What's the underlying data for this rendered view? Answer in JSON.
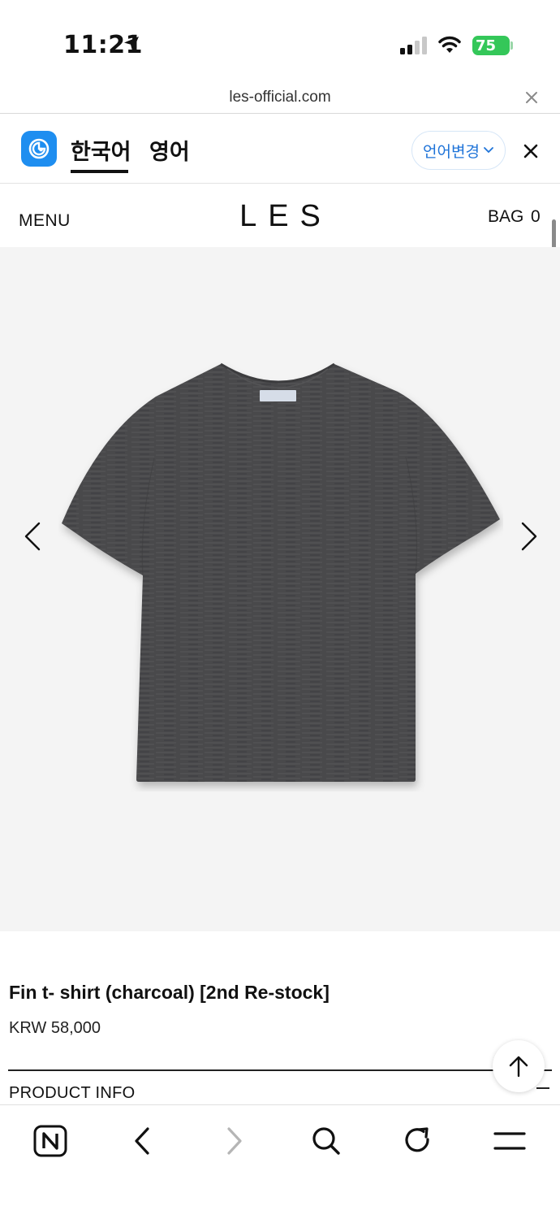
{
  "status_bar": {
    "time": "11:21",
    "battery": "75",
    "icons": [
      "location-arrow-icon",
      "cellular-signal-icon",
      "wifi-icon",
      "battery-icon"
    ]
  },
  "browser": {
    "url": "les-official.com"
  },
  "translate_bar": {
    "source_lang": "한국어",
    "target_lang": "영어",
    "change_label": "언어변경",
    "accent_color": "#1e8ef0"
  },
  "site": {
    "menu_label": "MENU",
    "logo": "LES",
    "bag_label": "BAG",
    "bag_count": "0"
  },
  "product": {
    "title": "Fin t- shirt (charcoal) [2nd Re-stock]",
    "price": "KRW 58,000",
    "info_label": "PRODUCT INFO",
    "image_color": "#4a4a4c"
  },
  "toolbar": {
    "icons": [
      "naver-home-icon",
      "back-icon",
      "forward-icon",
      "search-icon",
      "reload-icon",
      "menu-icon"
    ]
  }
}
